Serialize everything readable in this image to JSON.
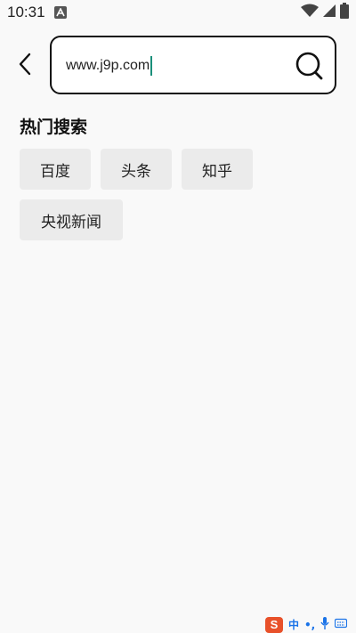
{
  "status_bar": {
    "time": "10:31",
    "notification_badge": "A",
    "icons": [
      "wifi-icon",
      "cellular-signal-icon",
      "battery-icon"
    ]
  },
  "search": {
    "value": "www.j9p.com",
    "back_icon": "chevron-left-icon",
    "search_icon": "magnifier-icon"
  },
  "hot_search": {
    "title": "热门搜索",
    "items": [
      {
        "label": "百度"
      },
      {
        "label": "头条"
      },
      {
        "label": "知乎"
      },
      {
        "label": "央视新闻"
      }
    ]
  },
  "ime": {
    "logo": "S",
    "mode": "中",
    "punct": "•,",
    "icons": [
      "microphone-icon",
      "keyboard-icon"
    ]
  },
  "colors": {
    "background": "#f9f9f9",
    "chip_bg": "#ebebeb",
    "caret": "#1a8f7a",
    "ime_logo": "#e8512a",
    "ime_accent": "#1a73e8"
  }
}
